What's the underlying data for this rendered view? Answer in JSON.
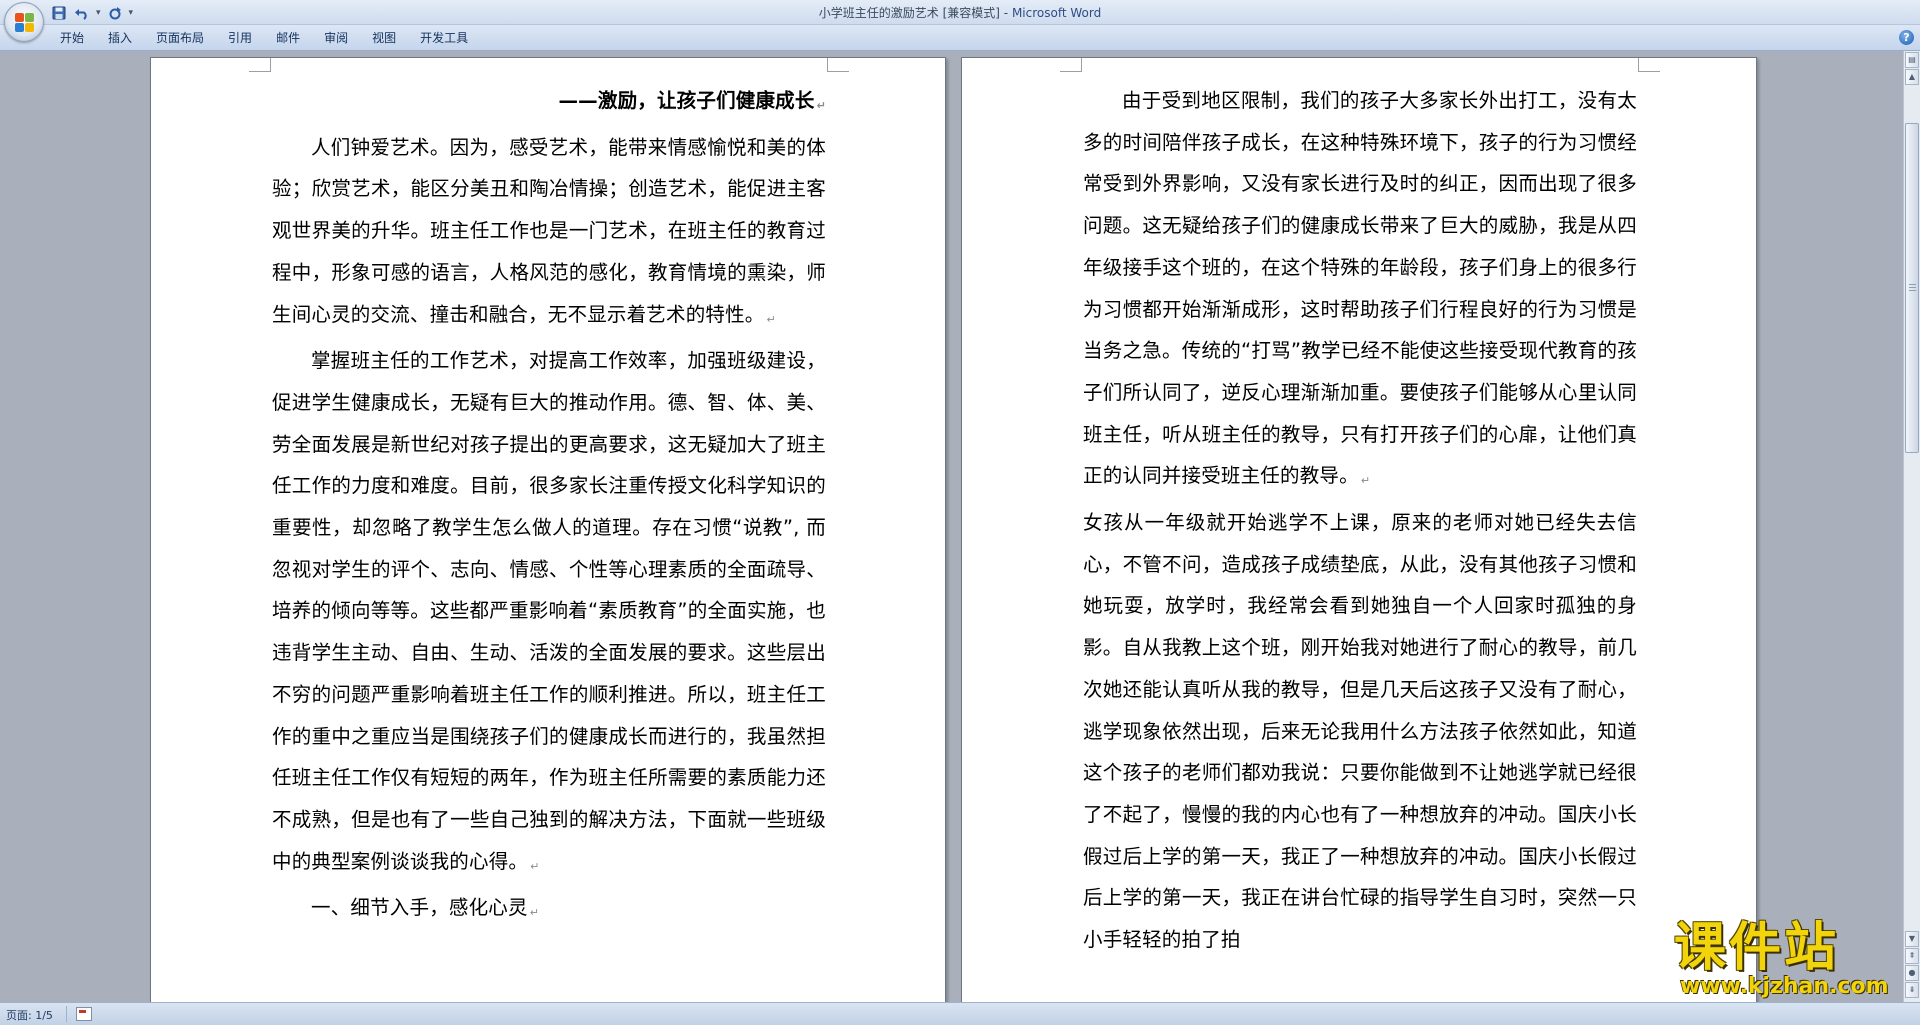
{
  "window": {
    "title_doc": "小学班主任的激励艺术 [兼容模式] -",
    "title_app": "Microsoft Word"
  },
  "ribbon": {
    "tabs": [
      "开始",
      "插入",
      "页面布局",
      "引用",
      "邮件",
      "审阅",
      "视图",
      "开发工具"
    ],
    "help": "?"
  },
  "quick_access": {
    "save_icon": "save-icon",
    "undo_icon": "undo-icon",
    "redo_icon": "redo-icon"
  },
  "doc": {
    "left_page": {
      "heading": "——激励，让孩子们健康成长",
      "paragraphs": [
        "人们钟爱艺术。因为，感受艺术，能带来情感愉悦和美的体验；欣赏艺术，能区分美丑和陶冶情操；创造艺术，能促进主客观世界美的升华。班主任工作也是一门艺术，在班主任的教育过程中，形象可感的语言，人格风范的感化，教育情境的熏染，师生间心灵的交流、撞击和融合，无不显示着艺术的特性。",
        "掌握班主任的工作艺术，对提高工作效率，加强班级建设，促进学生健康成长，无疑有巨大的推动作用。德、智、体、美、劳全面发展是新世纪对孩子提出的更高要求，这无疑加大了班主任工作的力度和难度。目前，很多家长注重传授文化科学知识的重要性，却忽略了教学生怎么做人的道理。存在习惯“说教”, 而忽视对学生的评个、志向、情感、个性等心理素质的全面疏导、培养的倾向等等。这些都严重影响着“素质教育”的全面实施，也违背学生主动、自由、生动、活泼的全面发展的要求。这些层出不穷的问题严重影响着班主任工作的顺利推进。所以，班主任工作的重中之重应当是围绕孩子们的健康成长而进行的，我虽然担任班主任工作仅有短短的两年，作为班主任所需要的素质能力还不成熟，但是也有了一些自己独到的解决方法，下面就一些班级中的典型案例谈谈我的心得。",
        "一、细节入手，感化心灵"
      ]
    },
    "right_page": {
      "paragraphs": [
        "由于受到地区限制，我们的孩子大多家长外出打工，没有太多的时间陪伴孩子成长，在这种特殊环境下，孩子的行为习惯经常受到外界影响，又没有家长进行及时的纠正，因而出现了很多问题。这无疑给孩子们的健康成长带来了巨大的威胁，我是从四年级接手这个班的，在这个特殊的年龄段，孩子们身上的很多行为习惯都开始渐渐成形，这时帮助孩子们行程良好的行为习惯是当务之急。传统的“打骂”教学已经不能使这些接受现代教育的孩子们所认同了，逆反心理渐渐加重。要使孩子们能够从心里认同班主任，听从班主任的教导，只有打开孩子们的心扉，让他们真正的认同并接受班主任的教导。",
        "女孩从一年级就开始逃学不上课，原来的老师对她已经失去信心，不管不问，造成孩子成绩垫底，从此，没有其他孩子习惯和她玩耍，放学时，我经常会看到她独自一个人回家时孤独的身影。自从我教上这个班，刚开始我对她进行了耐心的教导，前几次她还能认真听从我的教导，但是几天后这孩子又没有了耐心，逃学现象依然出现，后来无论我用什么方法孩子依然如此，知道这个孩子的老师们都劝我说：只要你能做到不让她逃学就已经很了不起了，慢慢的我的内心也有了一种想放弃的冲动。国庆小长假过后上学的第一天，我正了一种想放弃的冲动。国庆小长假过后上学的第一天，我正在讲台忙碌的指导学生自习时，突然一只小手轻轻的拍了拍"
      ]
    }
  },
  "status": {
    "page": "页面: 1/5"
  },
  "watermark": {
    "title": "课件站",
    "url": "www.kjzhan.com"
  },
  "colors": {
    "title_app": "#2e4d87",
    "watermark": "#f2d40c",
    "workspace": "#a9b0bb"
  }
}
